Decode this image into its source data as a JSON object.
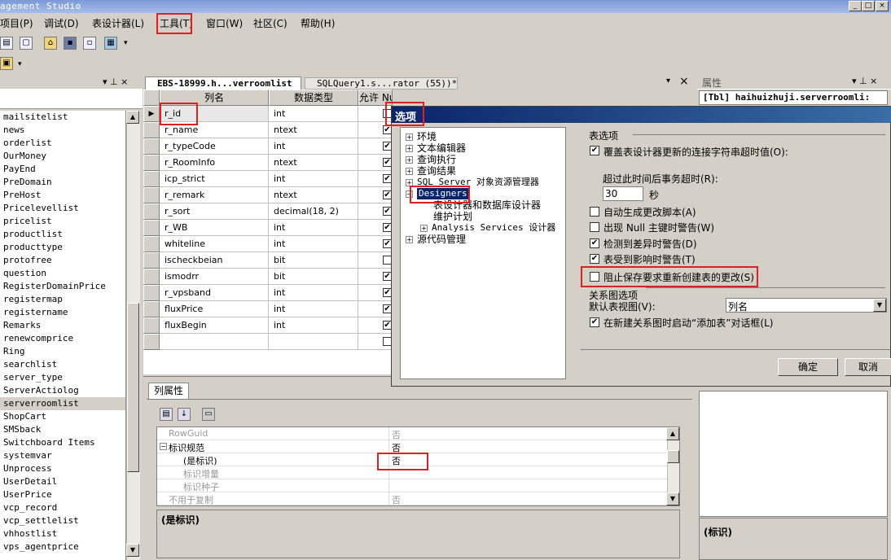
{
  "app": {
    "title": "agement Studio"
  },
  "window": {
    "min": "_",
    "max": "□",
    "close": "×"
  },
  "menu": {
    "items": [
      "项目(P)",
      "调试(D)",
      "表设计器(L)",
      "工具(T)",
      "窗口(W)",
      "社区(C)",
      "帮助(H)"
    ]
  },
  "left_panel": {
    "pin": "▾ ⊥ ×",
    "items": [
      "mailsitelist",
      "news",
      "orderlist",
      "OurMoney",
      "PayEnd",
      "PreDomain",
      "PreHost",
      "Pricelevellist",
      "pricelist",
      "productlist",
      "producttype",
      "protofree",
      "question",
      "RegisterDomainPrice",
      "registermap",
      "registername",
      "Remarks",
      "renewcomprice",
      "Ring",
      "searchlist",
      "server_type",
      "ServerActiolog",
      "serverroomlist",
      "ShopCart",
      "SMSback",
      "Switchboard Items",
      "systemvar",
      "Unprocess",
      "UserDetail",
      "UserPrice",
      "vcp_record",
      "vcp_settlelist",
      "vhhostlist",
      "vps_agentprice"
    ],
    "selected": "serverroomlist"
  },
  "tabs": {
    "tab1": "EBS-18999.h...verroomlist",
    "tab2": "SQLQuery1.s...rator (55))*",
    "close": "×",
    "arrow": "▾"
  },
  "grid": {
    "headers": [
      "列名",
      "数据类型",
      "允许 Null 值"
    ],
    "rows": [
      {
        "name": "r_id",
        "type": "int",
        "null": false
      },
      {
        "name": "r_name",
        "type": "ntext",
        "null": true
      },
      {
        "name": "r_typeCode",
        "type": "int",
        "null": true
      },
      {
        "name": "r_RoomInfo",
        "type": "ntext",
        "null": true
      },
      {
        "name": "icp_strict",
        "type": "int",
        "null": true
      },
      {
        "name": "r_remark",
        "type": "ntext",
        "null": true
      },
      {
        "name": "r_sort",
        "type": "decimal(18, 2)",
        "null": true
      },
      {
        "name": "r_WB",
        "type": "int",
        "null": true
      },
      {
        "name": "whiteline",
        "type": "int",
        "null": true
      },
      {
        "name": "ischeckbeian",
        "type": "bit",
        "null": false
      },
      {
        "name": "ismodrr",
        "type": "bit",
        "null": true
      },
      {
        "name": "r_vpsband",
        "type": "int",
        "null": true
      },
      {
        "name": "fluxPrice",
        "type": "int",
        "null": true
      },
      {
        "name": "fluxBegin",
        "type": "int",
        "null": true
      },
      {
        "name": "",
        "type": "",
        "null": false
      }
    ]
  },
  "props_panel": {
    "title": "属性",
    "object": "[Tbl] haihuizhuji.serverroomli:",
    "pin": "▾ ⊥ ×",
    "desc": "(标识)"
  },
  "col_props": {
    "tab": "列属性",
    "rows": [
      {
        "key": "RowGuid",
        "val": "否",
        "dim": true
      },
      {
        "key": "标识规范",
        "val": "否",
        "dim": false,
        "group": true
      },
      {
        "key": "(是标识)",
        "val": "否",
        "dim": false,
        "sub": true
      },
      {
        "key": "标识增量",
        "val": "",
        "dim": true,
        "sub": true
      },
      {
        "key": "标识种子",
        "val": "",
        "dim": true,
        "sub": true
      },
      {
        "key": "不用于复制",
        "val": "否",
        "dim": true
      }
    ],
    "desc": "(是标识)"
  },
  "dialog": {
    "title": "选项",
    "tree": [
      {
        "label": "环境",
        "level": 0,
        "exp": "+"
      },
      {
        "label": "文本编辑器",
        "level": 0,
        "exp": "+"
      },
      {
        "label": "查询执行",
        "level": 0,
        "exp": "+"
      },
      {
        "label": "查询结果",
        "level": 0,
        "exp": "+"
      },
      {
        "label": "SQL Server 对象资源管理器",
        "level": 0,
        "exp": "+"
      },
      {
        "label": "Designers",
        "level": 0,
        "exp": "-",
        "selected": true
      },
      {
        "label": "表设计器和数据库设计器",
        "level": 1,
        "exp": ""
      },
      {
        "label": "维护计划",
        "level": 1,
        "exp": ""
      },
      {
        "label": "Analysis Services 设计器",
        "level": 1,
        "exp": "+"
      },
      {
        "label": "源代码管理",
        "level": 0,
        "exp": "+"
      }
    ],
    "table_group": "表选项",
    "opt_override": "覆盖表设计器更新的连接字符串超时值(O):",
    "timeout_label": "超过此时间后事务超时(R):",
    "timeout_value": "30",
    "seconds": "秒",
    "opt_autoscript": "自动生成更改脚本(A)",
    "opt_nullwarn": "出现 Null 主键时警告(W)",
    "opt_diffwarn": "检测到差异时警告(D)",
    "opt_affectwarn": "表受到影响时警告(T)",
    "opt_prevent": "阻止保存要求重新创建表的更改(S)",
    "diagram_group": "关系图选项",
    "default_view_label": "默认表视图(V):",
    "default_view_value": "列名",
    "opt_addtable": "在新建关系图时启动“添加表”对话框(L)",
    "ok": "确定",
    "cancel": "取消"
  }
}
